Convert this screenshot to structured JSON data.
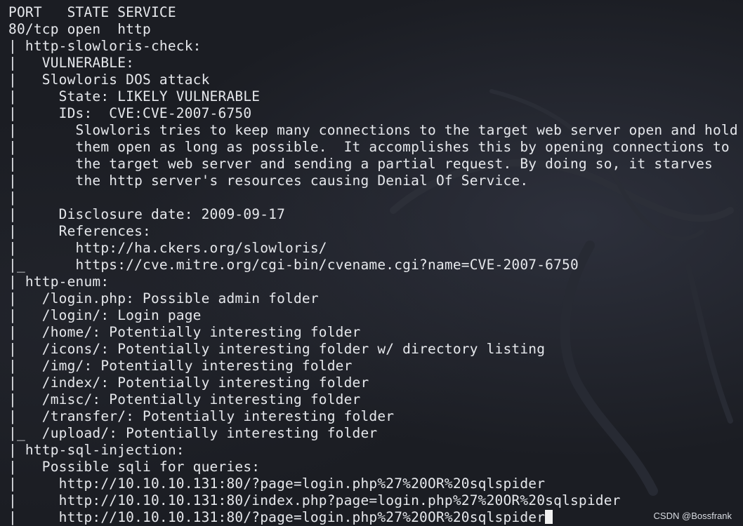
{
  "terminal": {
    "lines": [
      "PORT   STATE SERVICE",
      "80/tcp open  http",
      "| http-slowloris-check:",
      "|   VULNERABLE:",
      "|   Slowloris DOS attack",
      "|     State: LIKELY VULNERABLE",
      "|     IDs:  CVE:CVE-2007-6750",
      "|       Slowloris tries to keep many connections to the target web server open and hold",
      "|       them open as long as possible.  It accomplishes this by opening connections to",
      "|       the target web server and sending a partial request. By doing so, it starves",
      "|       the http server's resources causing Denial Of Service.",
      "|",
      "|     Disclosure date: 2009-09-17",
      "|     References:",
      "|       http://ha.ckers.org/slowloris/",
      "|_      https://cve.mitre.org/cgi-bin/cvename.cgi?name=CVE-2007-6750",
      "| http-enum:",
      "|   /login.php: Possible admin folder",
      "|   /login/: Login page",
      "|   /home/: Potentially interesting folder",
      "|   /icons/: Potentially interesting folder w/ directory listing",
      "|   /img/: Potentially interesting folder",
      "|   /index/: Potentially interesting folder",
      "|   /misc/: Potentially interesting folder",
      "|   /transfer/: Potentially interesting folder",
      "|_  /upload/: Potentially interesting folder",
      "| http-sql-injection:",
      "|   Possible sqli for queries:",
      "|     http://10.10.10.131:80/?page=login.php%27%20OR%20sqlspider",
      "|     http://10.10.10.131:80/index.php?page=login.php%27%20OR%20sqlspider",
      "|     http://10.10.10.131:80/?page=login.php%27%20OR%20sqlspider"
    ]
  },
  "watermark": "CSDN @Bossfrank",
  "colors": {
    "background": "#1b1d23",
    "text": "#e6e8ec",
    "cursor": "#f2f2f2"
  }
}
